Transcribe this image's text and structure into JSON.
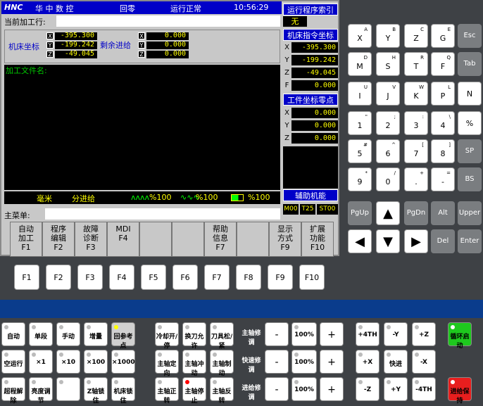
{
  "header": {
    "brand": "华 中 数 控",
    "mode": "回零",
    "status": "运行正常",
    "time": "10:56:29"
  },
  "current_program_label": "当前加工行:",
  "machine_coords_label": "机床坐标",
  "remaining_label": "剩余进给",
  "machine_coords": [
    {
      "axis": "X",
      "value": "-395.300"
    },
    {
      "axis": "Y",
      "value": "-199.242"
    },
    {
      "axis": "Z",
      "value": "-49.045"
    }
  ],
  "remaining": [
    {
      "axis": "X",
      "value": "0.000"
    },
    {
      "axis": "Y",
      "value": "0.000"
    },
    {
      "axis": "Z",
      "value": "0.000"
    }
  ],
  "file_label": "加工文件名:",
  "status_bar": {
    "unit": "毫米",
    "feed": "分进给",
    "feed_rate": "%100",
    "rapid_rate": "%100",
    "spindle_rate": "%100"
  },
  "main_menu_label": "主菜单:",
  "right_panel": {
    "index_title": "运行程序索引",
    "index_value": "无",
    "cmd_title": "机床指令坐标",
    "cmd_coords": [
      {
        "axis": "X",
        "value": "-395.300"
      },
      {
        "axis": "Y",
        "value": "-199.242"
      },
      {
        "axis": "Z",
        "value": "-49.045"
      },
      {
        "axis": "F",
        "value": "0.000"
      }
    ],
    "work_title": "工件坐标零点",
    "work_coords": [
      {
        "axis": "X",
        "value": "0.000"
      },
      {
        "axis": "Y",
        "value": "0.000"
      },
      {
        "axis": "Z",
        "value": "0.000"
      }
    ],
    "aux_title": "辅助机能",
    "aux": [
      "M00",
      "T25",
      "ST00"
    ]
  },
  "fkeys": [
    {
      "l1": "自动",
      "l2": "加工",
      "k": "F1"
    },
    {
      "l1": "程序",
      "l2": "编辑",
      "k": "F2"
    },
    {
      "l1": "故障",
      "l2": "诊断",
      "k": "F3"
    },
    {
      "l1": "MDI",
      "l2": "",
      "k": "F4"
    },
    {
      "l1": "",
      "l2": "",
      "k": ""
    },
    {
      "l1": "",
      "l2": "",
      "k": ""
    },
    {
      "l1": "帮助",
      "l2": "信息",
      "k": "F7"
    },
    {
      "l1": "",
      "l2": "",
      "k": ""
    },
    {
      "l1": "显示",
      "l2": "方式",
      "k": "F9"
    },
    {
      "l1": "扩展",
      "l2": "功能",
      "k": "F10"
    }
  ],
  "fbuttons": [
    "F1",
    "F2",
    "F3",
    "F4",
    "F5",
    "F6",
    "F7",
    "F8",
    "F9",
    "F10"
  ],
  "keypad": [
    [
      "X",
      "A"
    ],
    [
      "Y",
      "B"
    ],
    [
      "Z",
      "C"
    ],
    [
      "G",
      "E"
    ],
    [
      "M",
      "D"
    ],
    [
      "S",
      "H"
    ],
    [
      "T",
      "R"
    ],
    [
      "F",
      "Q"
    ],
    [
      "I",
      "U"
    ],
    [
      "J",
      "V"
    ],
    [
      "K",
      "W"
    ],
    [
      "P",
      "L"
    ],
    [
      "1",
      "\""
    ],
    [
      "2",
      ";"
    ],
    [
      "3",
      ":"
    ],
    [
      "4",
      "\\"
    ],
    [
      "5",
      "#"
    ],
    [
      "6",
      "^"
    ],
    [
      "7",
      "["
    ],
    [
      "8",
      "]"
    ],
    [
      "9",
      "*"
    ],
    [
      "0",
      "/"
    ],
    [
      ".",
      "+"
    ],
    [
      "-",
      "="
    ]
  ],
  "keypad_extra": [
    "Esc",
    "Tab",
    "N",
    "%",
    "SP",
    "BS",
    "Upper",
    "Enter"
  ],
  "nav": [
    "PgUp",
    "PgDn",
    "Alt",
    "Del"
  ],
  "op_left": [
    [
      "自动",
      "单段",
      "手动",
      "增量",
      "回参考点"
    ],
    [
      "空运行",
      "×1",
      "×10",
      "×100",
      "×1000"
    ],
    [
      "超程解除",
      "亮度调节",
      "",
      "Z轴锁住",
      "机床锁住"
    ]
  ],
  "op_mid": [
    [
      "冷却开/停",
      "换刀允许",
      "刀具松/紧"
    ],
    [
      "主轴定向",
      "主轴冲动",
      "主轴制动"
    ],
    [
      "主轴正转",
      "主轴停止",
      "主轴反转"
    ]
  ],
  "override_labels": [
    "主轴修调",
    "快速修调",
    "进给修调"
  ],
  "override_values": [
    "100%",
    "100%",
    "100%"
  ],
  "override_minus": "-",
  "override_plus": "+",
  "jog": [
    [
      "+4TH",
      "-Y",
      "+Z"
    ],
    [
      "+X",
      "快进",
      "-X"
    ],
    [
      "-Z",
      "+Y",
      "-4TH"
    ]
  ],
  "cycle": {
    "start": "循环启动",
    "hold": "进给保持"
  }
}
